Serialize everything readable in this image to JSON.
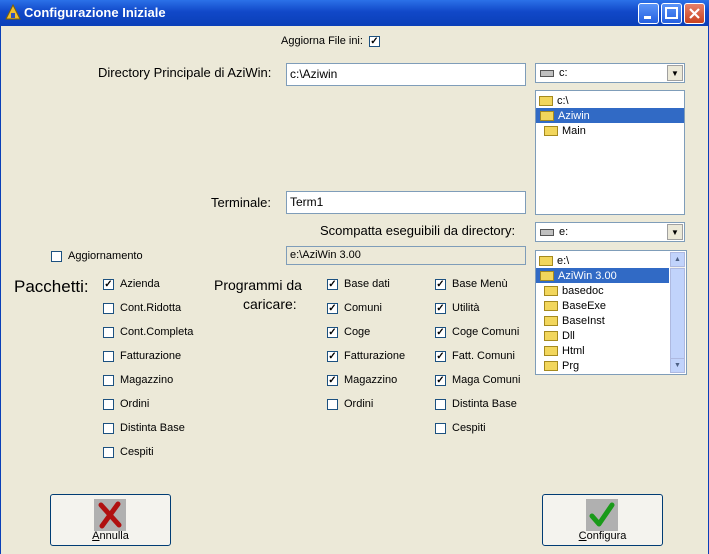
{
  "window": {
    "title": "Configurazione Iniziale"
  },
  "aggiorna": {
    "label": "Aggiorna File ini:",
    "checked": true
  },
  "directory": {
    "label": "Directory Principale di AziWin:",
    "value": "c:\\Aziwin"
  },
  "drive_top": {
    "value": "c:"
  },
  "folders_top": {
    "items": [
      "c:\\",
      "Aziwin",
      "Main"
    ],
    "selected": "Aziwin"
  },
  "terminale": {
    "label": "Terminale:",
    "value": "Term1"
  },
  "scompatta": {
    "label": "Scompatta eseguibili da directory:"
  },
  "drive_bottom": {
    "value": "e:"
  },
  "aggiornamento": {
    "label": "Aggiornamento",
    "checked": false,
    "path": "e:\\AziWin 3.00"
  },
  "folders_bottom": {
    "items": [
      "e:\\",
      "AziWin 3.00",
      "basedoc",
      "BaseExe",
      "BaseInst",
      "Dll",
      "Html",
      "Prg"
    ],
    "selected": "AziWin 3.00"
  },
  "pacchetti": {
    "label": "Pacchetti:",
    "items": [
      {
        "label": "Azienda",
        "checked": true
      },
      {
        "label": "Cont.Ridotta",
        "checked": false
      },
      {
        "label": "Cont.Completa",
        "checked": false
      },
      {
        "label": "Fatturazione",
        "checked": false
      },
      {
        "label": "Magazzino",
        "checked": false
      },
      {
        "label": "Ordini",
        "checked": false
      },
      {
        "label": "Distinta Base",
        "checked": false
      },
      {
        "label": "Cespiti",
        "checked": false
      }
    ]
  },
  "programmi": {
    "label_line1": "Programmi da",
    "label_line2": "caricare:",
    "col1": [
      {
        "label": "Base dati",
        "checked": true
      },
      {
        "label": "Comuni",
        "checked": true
      },
      {
        "label": "Coge",
        "checked": true
      },
      {
        "label": "Fatturazione",
        "checked": true
      },
      {
        "label": "Magazzino",
        "checked": true
      },
      {
        "label": "Ordini",
        "checked": false
      }
    ],
    "col2": [
      {
        "label": "Base Menù",
        "checked": true
      },
      {
        "label": "Utilità",
        "checked": true
      },
      {
        "label": "Coge Comuni",
        "checked": true
      },
      {
        "label": "Fatt. Comuni",
        "checked": true
      },
      {
        "label": "Maga Comuni",
        "checked": true
      },
      {
        "label": "Distinta Base",
        "checked": false
      },
      {
        "label": "Cespiti",
        "checked": false
      }
    ]
  },
  "buttons": {
    "annulla": {
      "label_first": "A",
      "label_rest": "nnulla"
    },
    "configura": {
      "label_first": "C",
      "label_rest": "onfigura"
    }
  },
  "icons": {
    "cancel": "x-icon",
    "ok": "checkmark-icon"
  },
  "colors": {
    "titlebar": "#0a3fb8",
    "selection": "#316ac5",
    "cancel_icon": "#b01010",
    "ok_icon": "#1a9a1a"
  }
}
